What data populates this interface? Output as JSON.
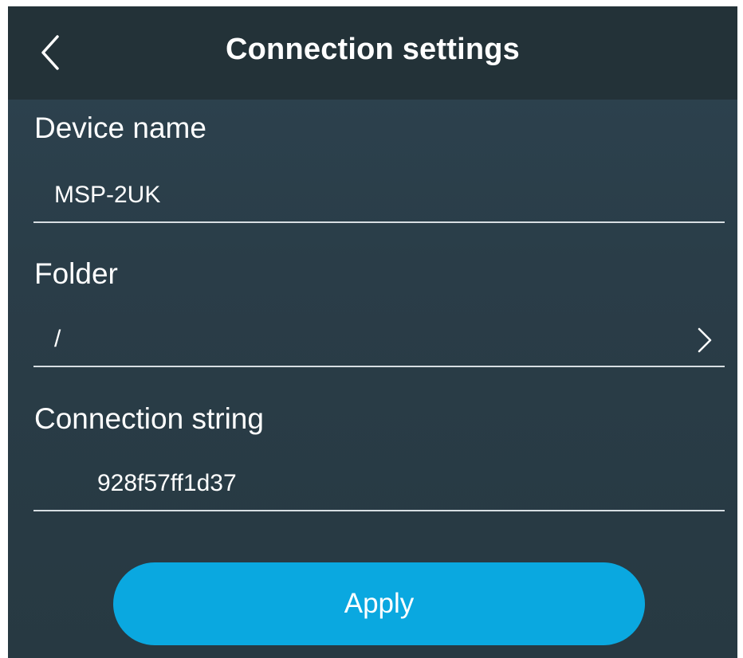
{
  "header": {
    "title": "Connection settings",
    "back_icon": "chevron-left-icon"
  },
  "form": {
    "device_name": {
      "label": "Device name",
      "value": "MSP-2UK"
    },
    "folder": {
      "label": "Folder",
      "value": "/",
      "icon": "chevron-right-icon"
    },
    "connection_string": {
      "label": "Connection string",
      "value": "928f57ff1d37"
    }
  },
  "actions": {
    "apply_label": "Apply"
  },
  "colors": {
    "header_bg": "#233238",
    "screen_bg": "#2b3e49",
    "accent": "#0aa8e0",
    "text": "#ffffff",
    "divider": "#d7dee2"
  }
}
